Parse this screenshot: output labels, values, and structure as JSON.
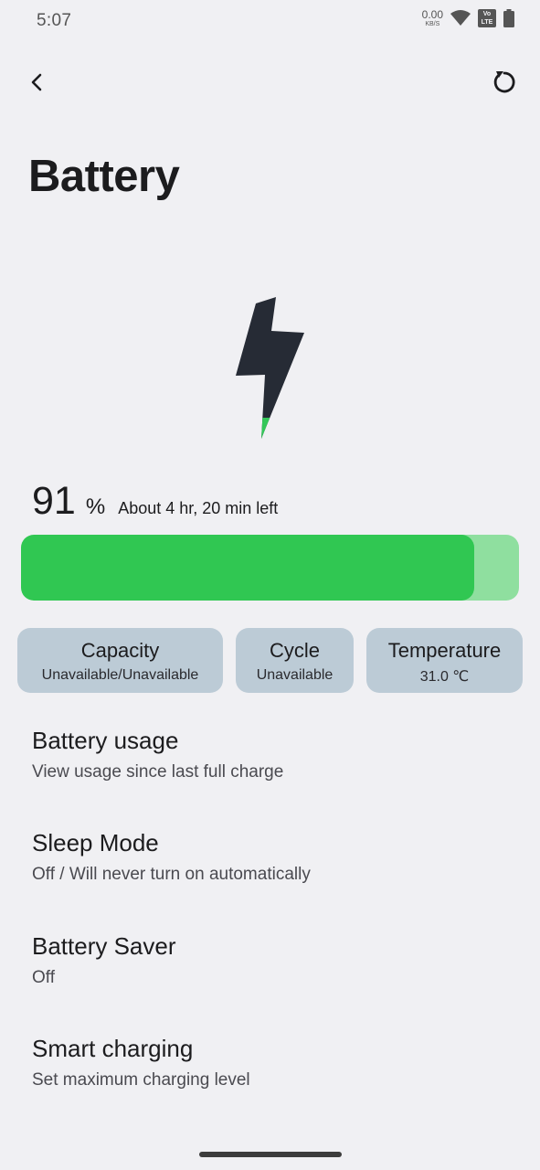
{
  "status": {
    "time": "5:07",
    "net_speed_value": "0.00",
    "net_speed_unit": "KB/S",
    "volte_top": "Vo",
    "volte_bottom": "LTE"
  },
  "header": {
    "title": "Battery"
  },
  "battery": {
    "percent": "91",
    "percent_sign": "%",
    "time_left": "About 4 hr, 20 min left",
    "level_fraction": 0.91,
    "fill_color": "#30c752",
    "track_color": "#8fdf9f"
  },
  "chips": [
    {
      "title": "Capacity",
      "value": "Unavailable/Unavailable"
    },
    {
      "title": "Cycle",
      "value": "Unavailable"
    },
    {
      "title": "Temperature",
      "value": "31.0 ℃"
    }
  ],
  "settings": [
    {
      "title": "Battery usage",
      "subtitle": "View usage since last full charge"
    },
    {
      "title": "Sleep Mode",
      "subtitle": "Off / Will never turn on automatically"
    },
    {
      "title": "Battery Saver",
      "subtitle": "Off"
    },
    {
      "title": "Smart charging",
      "subtitle": "Set maximum charging level"
    }
  ],
  "icons": {
    "back": "back-arrow-icon",
    "refresh": "refresh-icon",
    "bolt": "lightning-bolt-icon",
    "wifi": "wifi-icon",
    "battery": "battery-icon"
  }
}
